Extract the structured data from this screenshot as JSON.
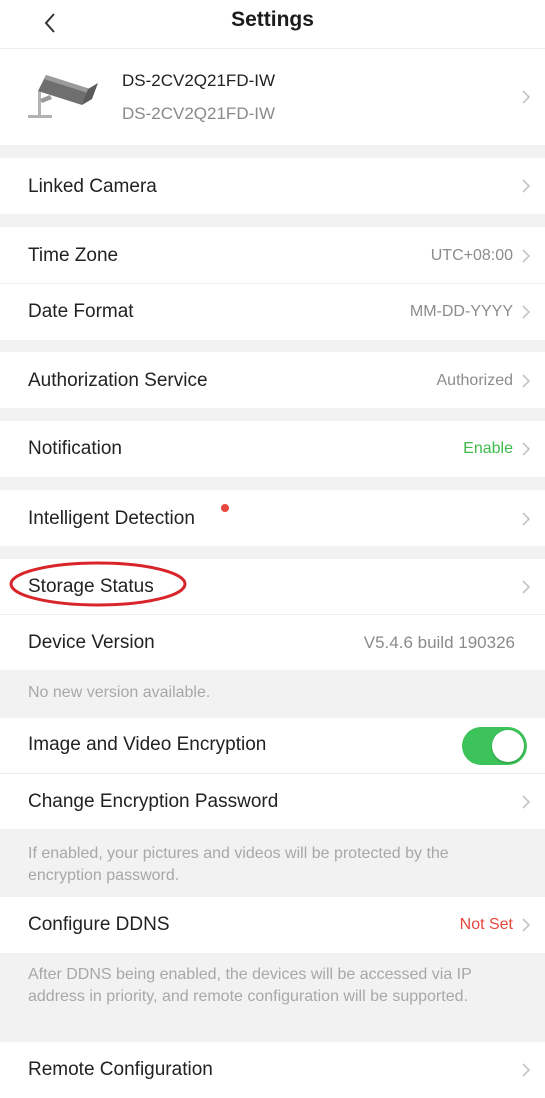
{
  "header": {
    "title": "Settings"
  },
  "device": {
    "name": "DS-2CV2Q21FD-IW",
    "model": "DS-2CV2Q21FD-IW"
  },
  "rows": {
    "linked_camera": {
      "label": "Linked Camera"
    },
    "time_zone": {
      "label": "Time Zone",
      "value": "UTC+08:00"
    },
    "date_format": {
      "label": "Date Format",
      "value": "MM-DD-YYYY"
    },
    "authorization": {
      "label": "Authorization Service",
      "value": "Authorized"
    },
    "notification": {
      "label": "Notification",
      "value": "Enable"
    },
    "intelligent_detection": {
      "label": "Intelligent Detection"
    },
    "storage_status": {
      "label": "Storage Status"
    },
    "device_version": {
      "label": "Device Version",
      "value": "V5.4.6 build 190326"
    },
    "image_video_encryption": {
      "label": "Image and Video Encryption",
      "enabled": true
    },
    "change_encryption_password": {
      "label": "Change Encryption Password"
    },
    "configure_ddns": {
      "label": "Configure DDNS",
      "value": "Not Set"
    },
    "remote_configuration": {
      "label": "Remote Configuration"
    }
  },
  "notes": {
    "version": "No new version available.",
    "encryption": "If enabled, your pictures and videos will be protected by the encryption password.",
    "ddns": "After DDNS being enabled, the devices will be accessed via IP address in priority, and remote configuration will be supported."
  },
  "colors": {
    "enable": "#3dbb4a",
    "not_set": "#e6483d",
    "toggle_on": "#3cc45a",
    "highlight": "#d8252a"
  }
}
